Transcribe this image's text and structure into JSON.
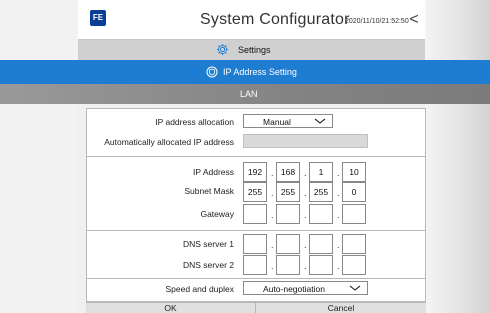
{
  "header": {
    "logo_text": "FE",
    "title": "System Configurator",
    "timestamp": "2020/11/10/21:52:50",
    "back_glyph": "<"
  },
  "settings_bar": {
    "icon": "gear-icon",
    "label": "Settings"
  },
  "ip_bar": {
    "icon": "shield-icon",
    "label": "IP Address Setting"
  },
  "lan_bar": {
    "label": "LAN"
  },
  "form": {
    "allocation": {
      "label": "IP address allocation",
      "value": "Manual"
    },
    "auto_ip": {
      "label": "Automatically allocated IP address",
      "value": ""
    },
    "ip_address": {
      "label": "IP Address",
      "octets": [
        "192",
        "168",
        "1",
        "10"
      ]
    },
    "subnet_mask": {
      "label": "Subnet Mask",
      "octets": [
        "255",
        "255",
        "255",
        "0"
      ]
    },
    "gateway": {
      "label": "Gateway",
      "octets": [
        "",
        "",
        "",
        ""
      ]
    },
    "dns1": {
      "label": "DNS server 1",
      "octets": [
        "",
        "",
        "",
        ""
      ]
    },
    "dns2": {
      "label": "DNS server 2",
      "octets": [
        "",
        "",
        "",
        ""
      ]
    },
    "speed": {
      "label": "Speed and duplex",
      "value": "Auto-negotiation"
    }
  },
  "buttons": {
    "ok": "OK",
    "cancel": "Cancel"
  },
  "colors": {
    "accent_blue": "#1f7dd1",
    "settings_bar": "#d0d0d0",
    "lan_bar": "#838383",
    "logo": "#0a3e96"
  }
}
